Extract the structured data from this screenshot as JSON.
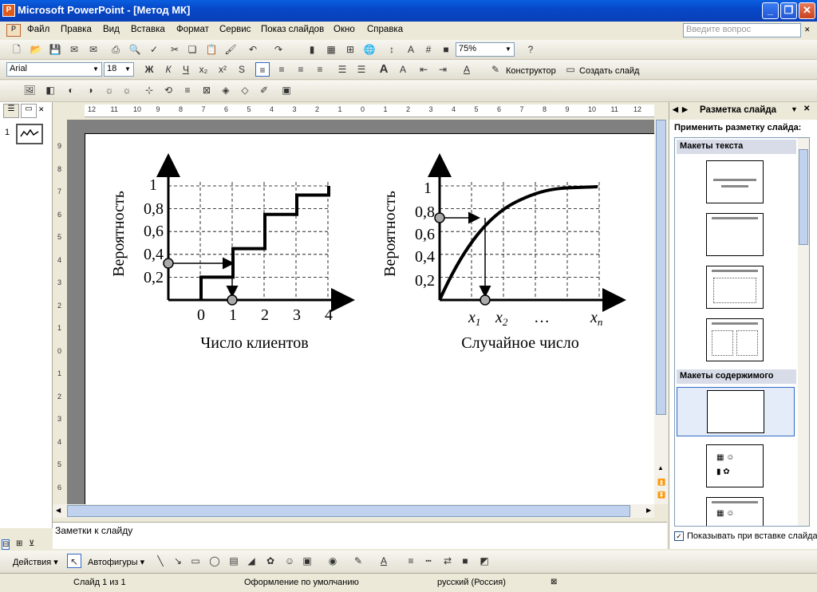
{
  "window": {
    "title": "Microsoft PowerPoint - [Метод МК]",
    "min_glyph": "_",
    "max_glyph": "❐",
    "close_glyph": "✕"
  },
  "menu": [
    "Файл",
    "Правка",
    "Вид",
    "Вставка",
    "Формат",
    "Сервис",
    "Показ слайдов",
    "Окно",
    "Справка"
  ],
  "ask_placeholder": "Введите вопрос",
  "toolbar": {
    "zoom": "75%",
    "font": "Arial",
    "size": "18",
    "bold": "Ж",
    "italic": "К",
    "underline": "Ч",
    "designer": "Конструктор",
    "new_slide": "Создать слайд"
  },
  "slides_panel": {
    "slide_number": "1"
  },
  "ruler": {
    "h_ticks": [
      "12",
      "11",
      "10",
      "9",
      "8",
      "7",
      "6",
      "5",
      "4",
      "3",
      "2",
      "1",
      "0",
      "1",
      "2",
      "3",
      "4",
      "5",
      "6",
      "7",
      "8",
      "9",
      "10",
      "11",
      "12"
    ],
    "v_ticks": [
      "9",
      "8",
      "7",
      "6",
      "5",
      "4",
      "3",
      "2",
      "1",
      "0",
      "1",
      "2",
      "3",
      "4",
      "5",
      "6"
    ]
  },
  "slide": {
    "left_chart": {
      "ylabel": "Вероятность",
      "xlabel": "Число клиентов",
      "yticks": [
        "1",
        "0,8",
        "0,6",
        "0,4",
        "0,2"
      ],
      "xticks": [
        "0",
        "1",
        "2",
        "3",
        "4"
      ]
    },
    "right_chart": {
      "ylabel": "Вероятность",
      "xlabel": "Случайное число",
      "yticks": [
        "1",
        "0,8",
        "0,6",
        "0,4",
        "0,2"
      ],
      "xticks": [
        "x1",
        "x2",
        "…",
        "xn"
      ],
      "x1_base": "x",
      "x1_sub": "1",
      "x2_base": "x",
      "x2_sub": "2",
      "ell": "…",
      "xn_base": "x",
      "xn_sub": "n"
    }
  },
  "chart_data": [
    {
      "type": "line",
      "xlabel": "Число клиентов",
      "ylabel": "Вероятность",
      "x": [
        0,
        1,
        2,
        3,
        4
      ],
      "y": [
        0.2,
        0.45,
        0.75,
        0.92,
        1.0
      ],
      "step": true,
      "ylim": [
        0,
        1
      ],
      "grid": true
    },
    {
      "type": "line",
      "xlabel": "Случайное число",
      "ylabel": "Вероятность",
      "ylim": [
        0,
        1
      ],
      "grid": true
    }
  ],
  "notes": {
    "text": "Заметки к слайду"
  },
  "task_pane": {
    "title": "Разметка слайда",
    "apply": "Применить разметку слайда:",
    "section_text": "Макеты текста",
    "section_content": "Макеты содержимого",
    "show_on_insert": "Показывать при вставке слайда"
  },
  "drawbar": {
    "actions": "Действия",
    "autoshapes": "Автофигуры"
  },
  "status": {
    "slide": "Слайд 1 из 1",
    "design": "Оформление по умолчанию",
    "lang": "русский (Россия)"
  }
}
